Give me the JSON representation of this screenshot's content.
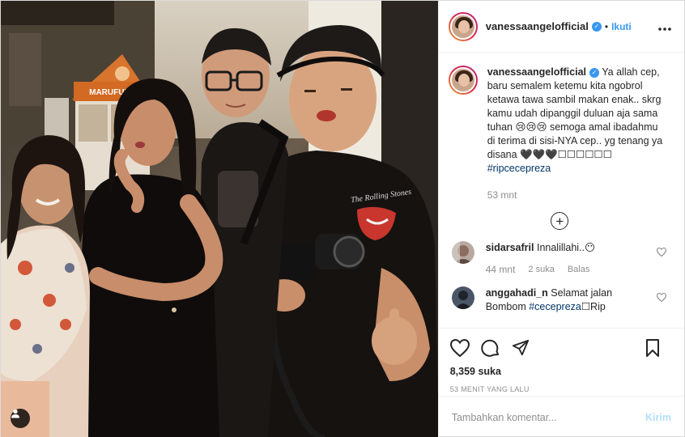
{
  "post": {
    "username": "vanessaangelofficial",
    "follow_label": "Ikuti",
    "more_icon": "ellipsis-icon",
    "caption": {
      "username": "vanessaangelofficial",
      "text": "Ya allah cep, baru semalem ketemu kita ngobrol ketawa tawa sambil makan enak.. skrg kamu udah dipanggil duluan aja sama tuhan 😢😢😢 semoga amal ibadahmu di terima di sisi-NYA cep.. yg tenang ya disana 🖤🖤🖤☐☐☐☐☐☐",
      "hashtag": "#ripcecepreza",
      "time": "53 mnt"
    },
    "comments": [
      {
        "username": "sidarsafril",
        "text": "Innalillahi..😶",
        "time": "44 mnt",
        "likes": "2 suka",
        "reply_label": "Balas"
      },
      {
        "username": "anggahadi_n",
        "text": "Selamat jalan Bombom ",
        "hashtag": "#cecepreza",
        "suffix": "☐Rip"
      }
    ],
    "likes_count": "8,359 suka",
    "posted_ago": "53 MENIT YANG LALU",
    "comment_placeholder": "Tambahkan komentar...",
    "post_label": "Kirim"
  },
  "photo": {
    "sign_text": "MARUFUKU",
    "shirt_text": "The Rolling Stones"
  },
  "colors": {
    "accent": "#3897f0",
    "hashtag": "#003569",
    "muted": "#8e8e8e",
    "post_disabled": "#b2dffc"
  }
}
